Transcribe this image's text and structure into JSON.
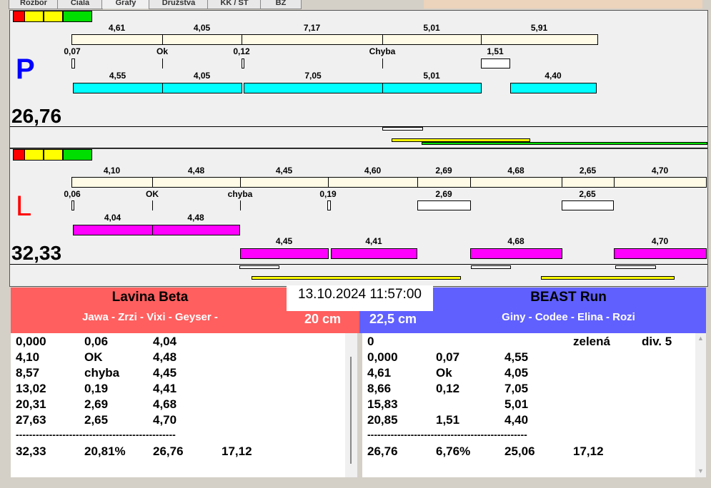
{
  "tabs": [
    "Rozbor",
    "Ciala",
    "Grafy",
    "Družstva",
    "KK / ST",
    "BZ"
  ],
  "colors": {
    "red": "#ff0000",
    "yellow": "#ffff00",
    "green": "#00dd00",
    "beige": "#fffbe6",
    "cyan": "#00ffff",
    "magenta": "#ff00ff",
    "team_left": "#ff5f5f",
    "team_right": "#6060ff"
  },
  "p_panel": {
    "letter": "P",
    "total": "26,76",
    "row1": [
      "4,61",
      "4,05",
      "7,17",
      "5,01",
      "5,91"
    ],
    "row2": [
      "0,07",
      "Ok",
      "0,12",
      "Chyba",
      "1,51"
    ],
    "row3": [
      "4,55",
      "4,05",
      "7,05",
      "5,01",
      "4,40"
    ]
  },
  "l_panel": {
    "letter": "L",
    "total": "32,33",
    "row1": [
      "4,10",
      "4,48",
      "4,45",
      "4,60",
      "2,69",
      "4,68",
      "2,65",
      "4,70"
    ],
    "row2": [
      "0,06",
      "OK",
      "chyba",
      "0,19",
      "2,69",
      "2,65"
    ],
    "row3": [
      "4,04",
      "4,48"
    ],
    "row4": [
      "4,45",
      "4,41",
      "4,68",
      "4,70"
    ]
  },
  "datetime": "13.10.2024 11:57:00",
  "left_team": {
    "name": "Lavina Beta",
    "members": "Jawa - Zrzi - Vixi - Geyser -",
    "height": "20 cm",
    "rows": [
      [
        "0,000",
        "0,06",
        "4,04",
        ""
      ],
      [
        "4,10",
        "OK",
        "4,48",
        ""
      ],
      [
        "8,57",
        "chyba",
        "4,45",
        ""
      ],
      [
        "13,02",
        "0,19",
        "4,41",
        ""
      ],
      [
        "20,31",
        "2,69",
        "4,68",
        ""
      ],
      [
        "27,63",
        "2,65",
        "4,70",
        ""
      ]
    ],
    "separator": "------------------------------------------------",
    "totals": [
      "32,33",
      "20,81%",
      "26,76",
      "17,12"
    ]
  },
  "right_team": {
    "name": "BEAST Run",
    "members": "Giny - Codee - Elina - Rozi",
    "height": "22,5 cm",
    "rows": [
      [
        "0",
        "",
        "",
        "zelená",
        "div. 5"
      ],
      [
        "0,000",
        "0,07",
        "4,55",
        "",
        ""
      ],
      [
        "4,61",
        "Ok",
        "4,05",
        "",
        ""
      ],
      [
        "8,66",
        "0,12",
        "7,05",
        "",
        ""
      ],
      [
        "15,83",
        "",
        "5,01",
        "",
        ""
      ],
      [
        "20,85",
        "1,51",
        "4,40",
        "",
        ""
      ]
    ],
    "separator": "------------------------------------------------",
    "totals": [
      "26,76",
      "6,76%",
      "25,06",
      "17,12"
    ]
  }
}
